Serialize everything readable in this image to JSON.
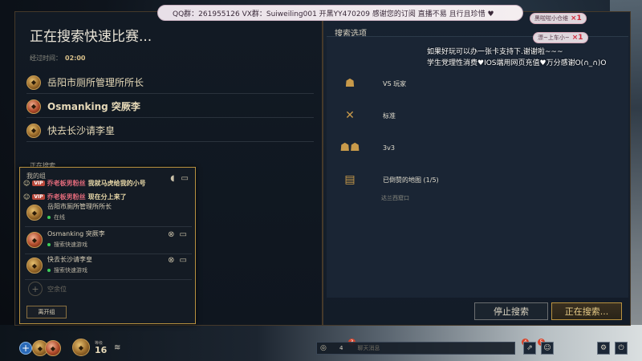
{
  "overlay": {
    "top_banner": "QQ群：261955126 VX群：Suiweiling001 开黑YY470209 感谢您的订阅 直播不易 且行且珍惜 ♥",
    "note_line1": "如果好玩可以办一张卡支持下.谢谢啦~~~",
    "note_line2": "学生党理性消费♥IOS端用网页充值♥万分感谢O(∩_∩)O",
    "gift1": {
      "text": "黑啦啦小仓维",
      "count": "×1"
    },
    "gift2": {
      "text": "漂~上车小~",
      "count": "×1"
    }
  },
  "left": {
    "title": "正在搜索快速比赛...",
    "elapsed_label": "经过时间：",
    "elapsed_value": "02:00",
    "players": [
      {
        "name": "岳阳市厕所管理所所长"
      },
      {
        "name": "Osmanking 突厥李"
      },
      {
        "name": "快去长沙请李皇"
      }
    ],
    "searching": "正在搜索..."
  },
  "group": {
    "title": "我的组",
    "chat": [
      {
        "tag": "VIP",
        "nick": "乔老板男粉丝",
        "msg": "我就马虎给我的小号"
      },
      {
        "tag": "VIP",
        "nick": "乔老板男粉丝",
        "msg": "现在分上来了"
      }
    ],
    "members": [
      {
        "name": "岳阳市厕所管理所所长",
        "status": "在线"
      },
      {
        "name": "Osmanking 突厥李",
        "status": "搜索快速游戏"
      },
      {
        "name": "快去长沙请李皇",
        "status": "搜索快速游戏"
      }
    ],
    "empty_slot": "空余位",
    "leave_label": "离开组"
  },
  "right": {
    "header": "搜索选项",
    "options": [
      {
        "icon": "vs-players-icon",
        "label": "VS 玩家"
      },
      {
        "icon": "standard-icon",
        "label": "标准"
      },
      {
        "icon": "team-size-icon",
        "label": "3v3"
      },
      {
        "icon": "map-icon",
        "label": "已倒赞的地图 (1/5)"
      }
    ],
    "map_sub": "达兰西窟口",
    "stop_label": "停止搜索",
    "searching_label": "正在搜索..."
  },
  "bottom": {
    "level_label": "等级",
    "level": "16",
    "chat_count": "4",
    "chat_placeholder": "聊天消息",
    "badge_chat": "3",
    "badge_a": "4",
    "badge_b": "5"
  }
}
